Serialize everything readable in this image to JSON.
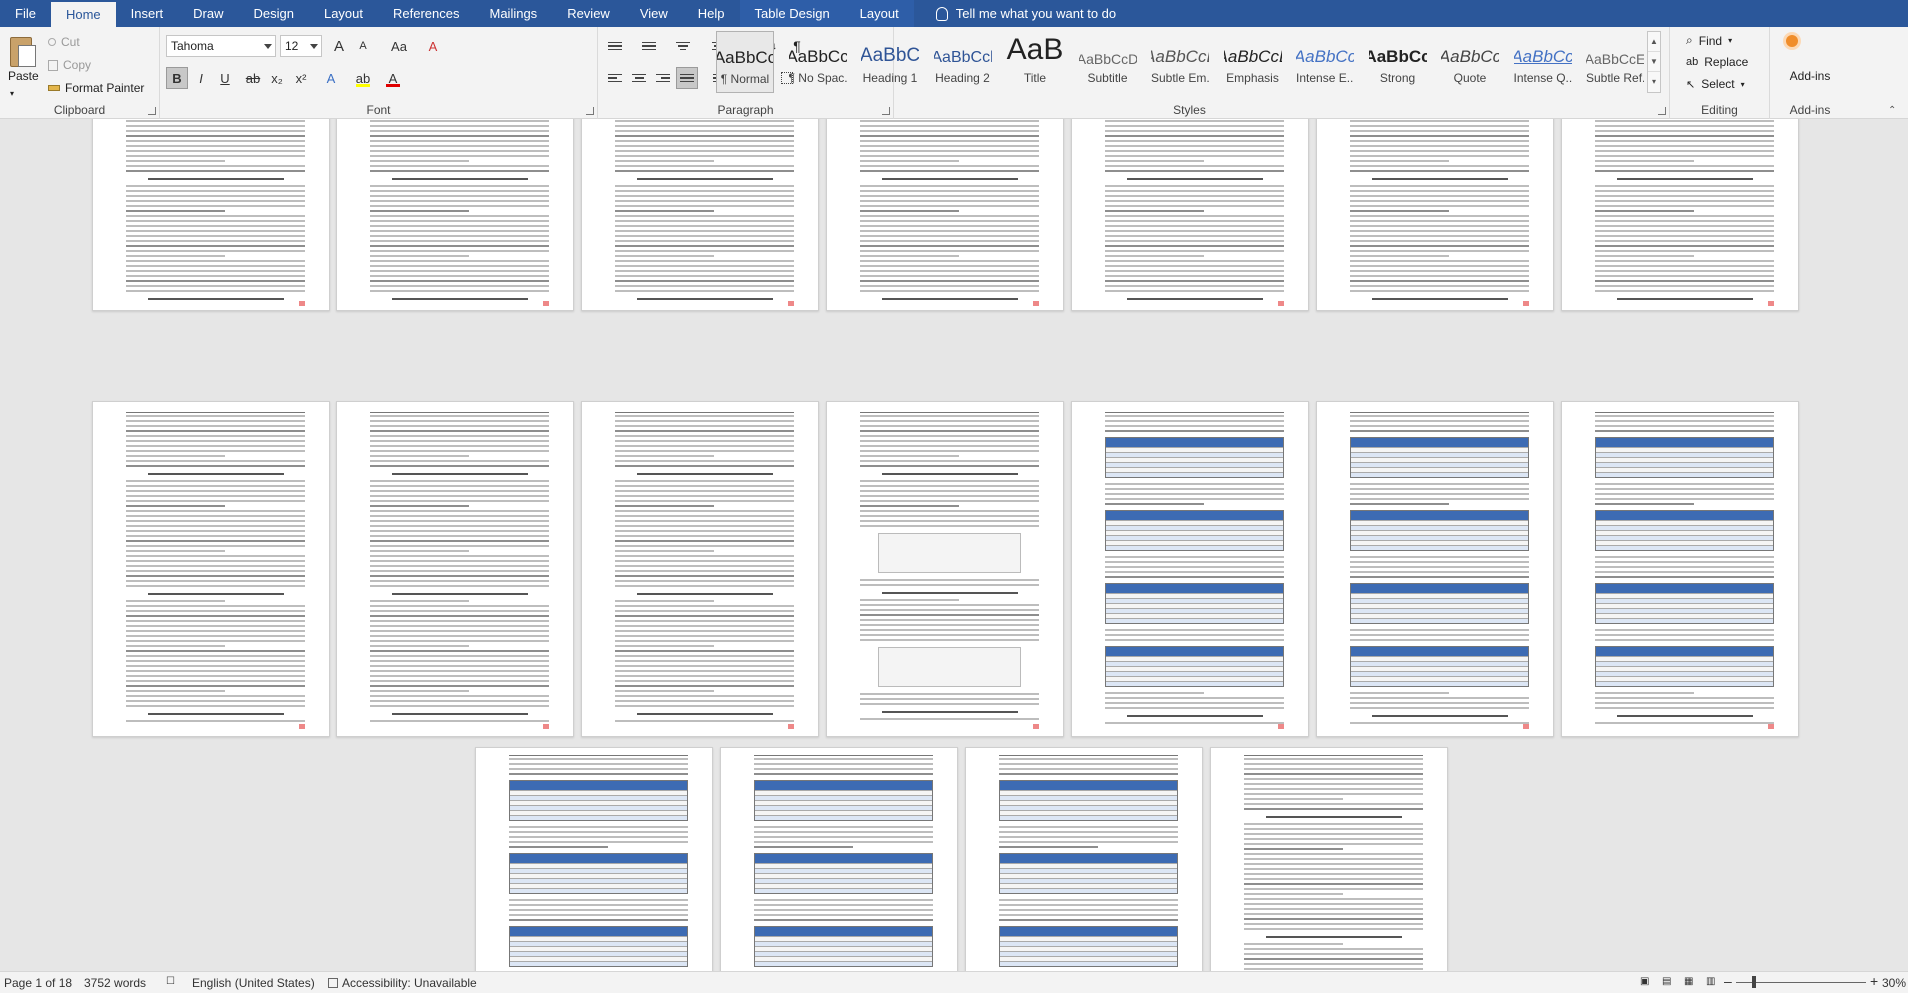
{
  "tabs": [
    "File",
    "Home",
    "Insert",
    "Draw",
    "Design",
    "Layout",
    "References",
    "Mailings",
    "Review",
    "View",
    "Help",
    "Table Design",
    "Layout"
  ],
  "active_tab": "Home",
  "tell_me": "Tell me what you want to do",
  "clipboard": {
    "label": "Clipboard",
    "paste": "Paste",
    "cut": "Cut",
    "copy": "Copy",
    "format_painter": "Format Painter"
  },
  "font": {
    "label": "Font",
    "name": "Tahoma",
    "size": "12",
    "bold": "B",
    "italic": "I",
    "underline": "U",
    "strike": "ab",
    "subscript": "x₂",
    "superscript": "x²",
    "grow": "A",
    "shrink": "A",
    "case": "Aa",
    "clear": "A",
    "effects": "A",
    "highlight": "ab",
    "color": "A",
    "highlight_color": "#ffff00",
    "font_color": "#e00000"
  },
  "paragraph": {
    "label": "Paragraph",
    "pilcrow": "¶"
  },
  "styles": {
    "label": "Styles",
    "items": [
      {
        "preview": "AaBbCc",
        "name": "¶ Normal"
      },
      {
        "preview": "AaBbCc",
        "name": "¶ No Spac..."
      },
      {
        "preview": "AaBbC",
        "name": "Heading 1"
      },
      {
        "preview": "AaBbCcl",
        "name": "Heading 2"
      },
      {
        "preview": "AaB",
        "name": "Title"
      },
      {
        "preview": "AaBbCcD",
        "name": "Subtitle"
      },
      {
        "preview": "AaBbCcL",
        "name": "Subtle Em..."
      },
      {
        "preview": "AaBbCcL",
        "name": "Emphasis"
      },
      {
        "preview": "AaBbCc",
        "name": "Intense E..."
      },
      {
        "preview": "AaBbCc",
        "name": "Strong"
      },
      {
        "preview": "AaBbCc",
        "name": "Quote"
      },
      {
        "preview": "AaBbCc",
        "name": "Intense Q..."
      },
      {
        "preview": "AaBbCcE",
        "name": "Subtle Ref..."
      }
    ]
  },
  "editing": {
    "label": "Editing",
    "find": "Find",
    "replace": "Replace",
    "select": "Select"
  },
  "addins": {
    "label": "Add-ins",
    "button": "Add-ins"
  },
  "status": {
    "page": "Page 1 of 18",
    "words": "3752 words",
    "language": "English (United States)",
    "accessibility": "Accessibility: Unavailable",
    "zoom": "30%",
    "zoom_minus": "–",
    "zoom_plus": "+"
  }
}
